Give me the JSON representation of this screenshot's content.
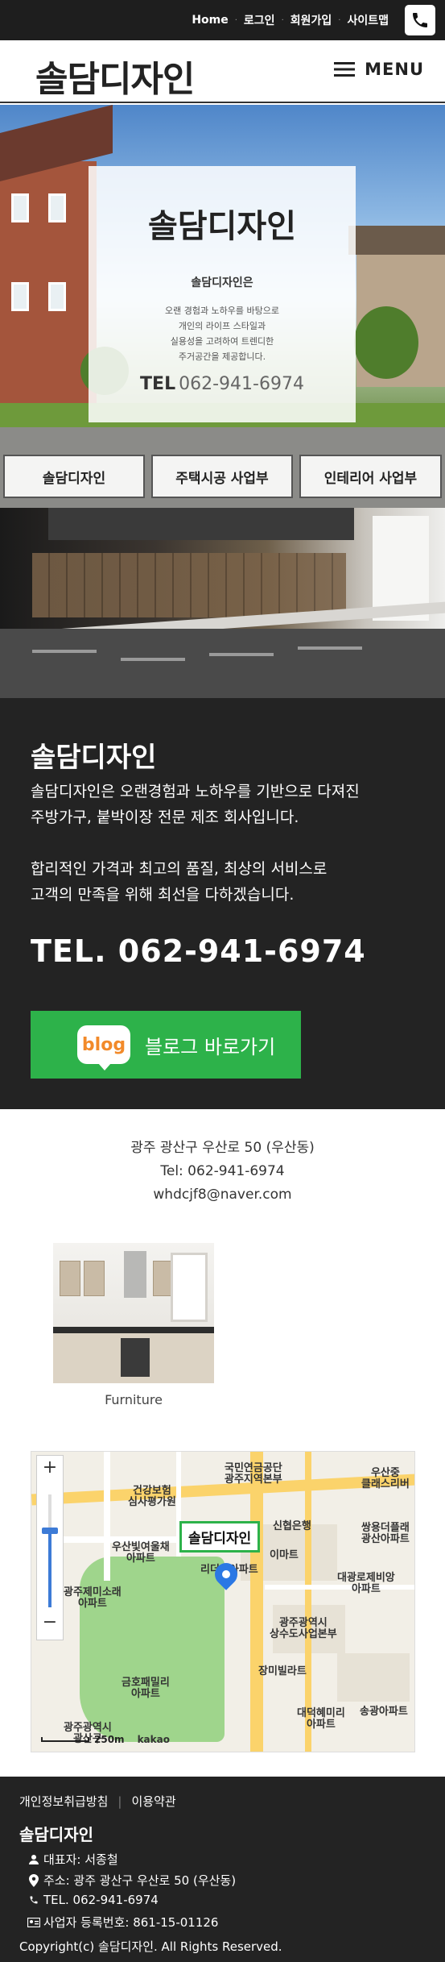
{
  "topbar": {
    "links": [
      "Home",
      "로그인",
      "회원가입",
      "사이트맵"
    ],
    "phone_icon": "phone-icon"
  },
  "header": {
    "logo": "솔담디자인",
    "menu_label": "MENU",
    "menu_icon": "hamburger-icon"
  },
  "hero": {
    "title": "솔담디자인",
    "subtitle": "솔담디자인은",
    "desc_lines": [
      "오랜 경험과 노하우를 바탕으로",
      "개인의 라이프 스타일과",
      "실용성을 고려하여 트렌디한",
      "주거공간을 제공합니다."
    ],
    "tel_label": "TEL",
    "tel_number": "062-941-6974",
    "tabs": [
      "솔담디자인",
      "주택시공 사업부",
      "인테리어 사업부"
    ]
  },
  "info": {
    "title": "솔담디자인",
    "text_lines": [
      "솔담디자인은 오랜경험과 노하우를 기반으로 다져진",
      "주방가구, 붙박이장 전문 제조 회사입니다."
    ],
    "text2_lines": [
      "합리적인 가격과 최고의 품질, 최상의 서비스로",
      "고객의 만족을 위해 최선을 다하겠습니다."
    ],
    "tel": "TEL. 062-941-6974",
    "blog_badge": "blog",
    "blog_button": "블로그 바로가기"
  },
  "address": {
    "line1": "광주 광산구 우산로 50 (우산동)",
    "line2": "Tel: 062-941-6974",
    "line3": "whdcjf8@naver.com"
  },
  "gallery": {
    "label": "Furniture"
  },
  "map": {
    "zoom_in": "+",
    "zoom_out": "−",
    "zoom_level": 0.68,
    "marker_label": "솔담디자인",
    "scale": "250m",
    "brand": "kakao",
    "labels": [
      "국민연금공단\n광주지역본부",
      "건강보험\n심사평가원",
      "우산빛여울채\n아파트",
      "리더스아파트",
      "이마트",
      "신협은행",
      "쌍용더플래\n광산아파트",
      "우산중\n클래스리버",
      "대광로제비앙\n아파트",
      "광주광역시\n상수도사업본부",
      "광주제미소래\n아파트",
      "금호패밀리\n아파트",
      "장미빌라트",
      "대덕혜미리\n아파트",
      "송광아파트",
      "광주광역시\n광산구"
    ]
  },
  "footer": {
    "links": [
      "개인정보취급방침",
      "이용약관"
    ],
    "brand": "솔담디자인",
    "rows": [
      {
        "icon": "user-icon",
        "text": "대표자: 서종철"
      },
      {
        "icon": "map-pin-icon",
        "text": "주소: 광주 광산구 우산로 50 (우산동)"
      },
      {
        "icon": "phone-icon",
        "text": "TEL. 062-941-6974"
      },
      {
        "icon": "id-card-icon",
        "text": "사업자 등록번호: 861-15-01126"
      }
    ],
    "copyright": "Copyright(c) 솔담디자인. All Rights Reserved."
  }
}
